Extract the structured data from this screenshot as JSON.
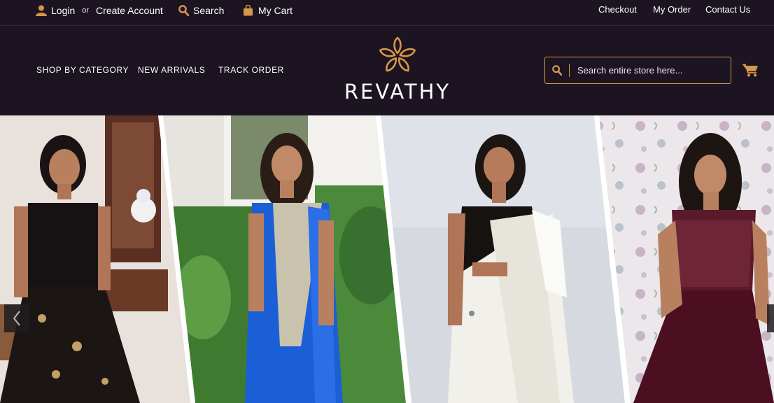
{
  "topbar": {
    "login_label": "Login",
    "or_label": "or",
    "create_account_label": "Create Account",
    "search_label": "Search",
    "cart_label": "My Cart",
    "checkout_label": "Checkout",
    "my_order_label": "My Order",
    "contact_label": "Contact Us"
  },
  "nav": {
    "shop_by_category": "SHOP BY CATEGORY",
    "new_arrivals": "NEW ARRIVALS",
    "track_order": "TRACK ORDER"
  },
  "brand": {
    "name": "REVATHY",
    "accent_color": "#d6974a",
    "background_color": "#1c1421"
  },
  "search": {
    "placeholder": "Search entire store here..."
  },
  "icons": {
    "user": "user-icon",
    "search": "search-icon",
    "bag": "shopping-bag-icon",
    "cart": "cart-icon",
    "prev": "chevron-left-icon",
    "next": "chevron-right-icon",
    "logo": "flower-logo-icon"
  },
  "banner": {
    "slides": [
      {
        "outfit": "black sequin crop top and skirt"
      },
      {
        "outfit": "blue silk saree"
      },
      {
        "outfit": "white kerala saree"
      },
      {
        "outfit": "maroon sequin gown"
      }
    ]
  }
}
